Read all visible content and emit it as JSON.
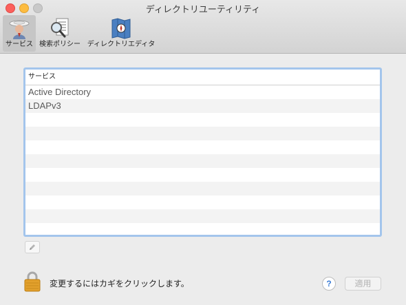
{
  "window": {
    "title": "ディレクトリユーティリティ"
  },
  "toolbar": {
    "items": [
      {
        "label": "サービス",
        "icon": "services-icon",
        "selected": true
      },
      {
        "label": "検索ポリシー",
        "icon": "search-policy-icon",
        "selected": false
      },
      {
        "label": "ディレクトリエディタ",
        "icon": "directory-editor-icon",
        "selected": false
      }
    ]
  },
  "services_table": {
    "header": "サービス",
    "rows": [
      "Active Directory",
      "LDAPv3"
    ]
  },
  "edit_button": {
    "icon": "pencil-icon"
  },
  "footer": {
    "lock_icon": "lock-icon",
    "lock_text": "変更するにはカギをクリックします。",
    "help_label": "?",
    "apply_label": "適用"
  },
  "colors": {
    "close": "#fc605c",
    "minimize": "#fdbc40",
    "zoom": "#c9c9c9",
    "list_focus_ring": "#a3c5ec",
    "help_accent": "#3a7bd5"
  }
}
